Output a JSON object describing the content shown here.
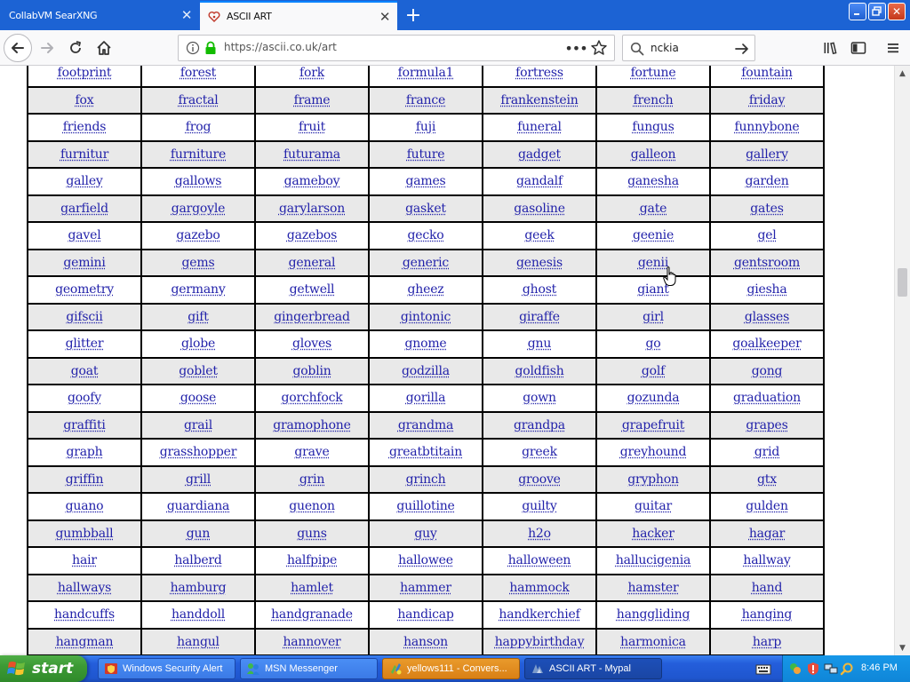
{
  "browser": {
    "tabs": [
      {
        "title": "CollabVM SearXNG",
        "active": false
      },
      {
        "title": "ASCII ART",
        "active": true
      }
    ],
    "url": "https://ascii.co.uk/art",
    "search": {
      "value": "nckia",
      "placeholder": ""
    }
  },
  "colors": {
    "link": "#2222aa",
    "row_alt": "#e9e9e9",
    "tab_strip": "#1c63d4",
    "active_tab_accent": "#0a84ff"
  },
  "word_table": {
    "rows": [
      [
        "footprint",
        "forest",
        "fork",
        "formula1",
        "fortress",
        "fortune",
        "fountain"
      ],
      [
        "fox",
        "fractal",
        "frame",
        "france",
        "frankenstein",
        "french",
        "friday"
      ],
      [
        "friends",
        "frog",
        "fruit",
        "fuji",
        "funeral",
        "fungus",
        "funnybone"
      ],
      [
        "furnitur",
        "furniture",
        "futurama",
        "future",
        "gadget",
        "galleon",
        "gallery"
      ],
      [
        "galley",
        "gallows",
        "gameboy",
        "games",
        "gandalf",
        "ganesha",
        "garden"
      ],
      [
        "garfield",
        "gargoyle",
        "garylarson",
        "gasket",
        "gasoline",
        "gate",
        "gates"
      ],
      [
        "gavel",
        "gazebo",
        "gazebos",
        "gecko",
        "geek",
        "geenie",
        "gel"
      ],
      [
        "gemini",
        "gems",
        "general",
        "generic",
        "genesis",
        "genii",
        "gentsroom"
      ],
      [
        "geometry",
        "germany",
        "getwell",
        "gheez",
        "ghost",
        "giant",
        "giesha"
      ],
      [
        "gifscii",
        "gift",
        "gingerbread",
        "gintonic",
        "giraffe",
        "girl",
        "glasses"
      ],
      [
        "glitter",
        "globe",
        "gloves",
        "gnome",
        "gnu",
        "go",
        "goalkeeper"
      ],
      [
        "goat",
        "goblet",
        "goblin",
        "godzilla",
        "goldfish",
        "golf",
        "gong"
      ],
      [
        "goofy",
        "goose",
        "gorchfock",
        "gorilla",
        "gown",
        "gozunda",
        "graduation"
      ],
      [
        "graffiti",
        "grail",
        "gramophone",
        "grandma",
        "grandpa",
        "grapefruit",
        "grapes"
      ],
      [
        "graph",
        "grasshopper",
        "grave",
        "greatbtitain",
        "greek",
        "greyhound",
        "grid"
      ],
      [
        "griffin",
        "grill",
        "grin",
        "grinch",
        "groove",
        "gryphon",
        "gtx"
      ],
      [
        "guano",
        "guardiana",
        "guenon",
        "guillotine",
        "guilty",
        "guitar",
        "gulden"
      ],
      [
        "gumbball",
        "gun",
        "guns",
        "guy",
        "h2o",
        "hacker",
        "hagar"
      ],
      [
        "hair",
        "halberd",
        "halfpipe",
        "hallowee",
        "halloween",
        "hallucigenia",
        "hallway"
      ],
      [
        "hallways",
        "hamburg",
        "hamlet",
        "hammer",
        "hammock",
        "hamster",
        "hand"
      ],
      [
        "handcuffs",
        "handdoll",
        "handgranade",
        "handicap",
        "handkerchief",
        "hanggliding",
        "hanging"
      ],
      [
        "hangman",
        "hangul",
        "hannover",
        "hanson",
        "happybirthday",
        "harmonica",
        "harp"
      ]
    ]
  },
  "taskbar": {
    "start_label": "start",
    "tasks": [
      {
        "label": "Windows Security Alert",
        "icon": "shield-alert-icon"
      },
      {
        "label": "MSN Messenger",
        "icon": "msn-icon"
      },
      {
        "label": "yellows111 - Convers...",
        "icon": "chat-icon"
      },
      {
        "label": "ASCII ART - Mypal",
        "icon": "browser-icon"
      }
    ],
    "clock": "8:46 PM"
  }
}
